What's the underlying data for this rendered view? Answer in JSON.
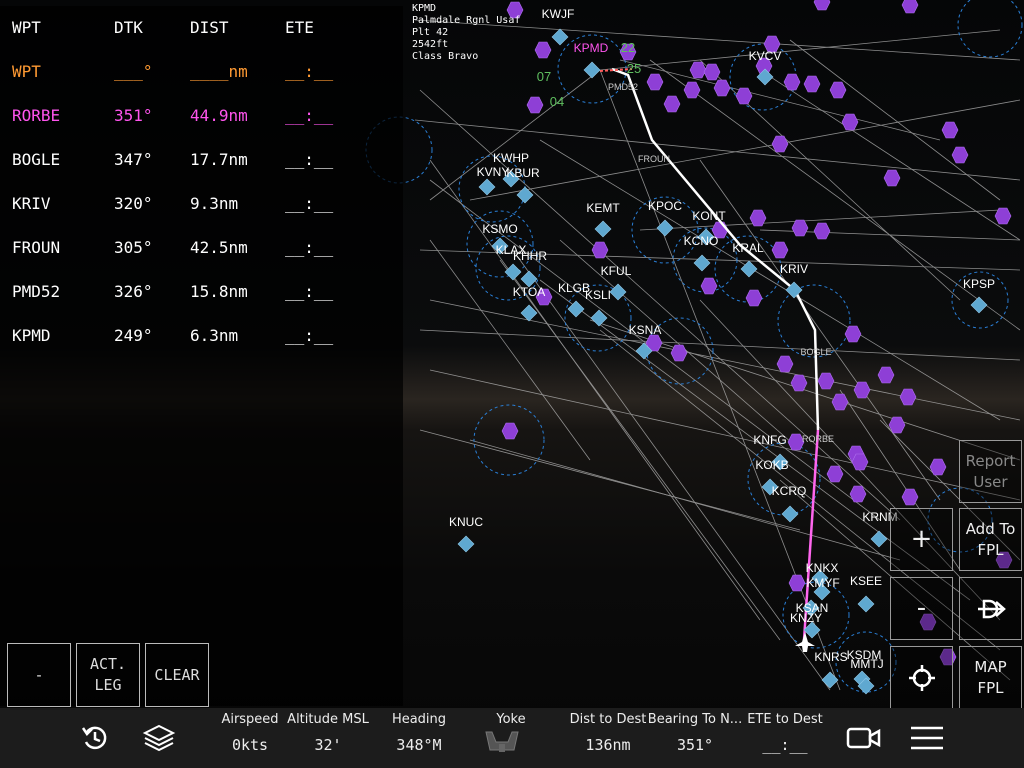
{
  "colors": {
    "active_waypoint": "#ff9a33",
    "next_waypoint": "#ff55ee",
    "normal_text": "#ffffff",
    "route_line": "#ffffff",
    "active_leg": "#ff66ee",
    "airport_fill": "#5fa8d0",
    "navaid_fill": "#8e3fd6",
    "range_ring": "#2a7fd6",
    "airway_line": "#b0b0b0",
    "runway_label": "#5fbf5f"
  },
  "flight_plan": {
    "headers": {
      "wpt": "WPT",
      "dtk": "DTK",
      "dist": "DIST",
      "ete": "ETE"
    },
    "rows": [
      {
        "wpt": "WPT",
        "dtk": "___°",
        "dist": "____nm",
        "ete": "__:__",
        "state": "active"
      },
      {
        "wpt": "RORBE",
        "dtk": "351°",
        "dist": "44.9nm",
        "ete": "__:__",
        "state": "next"
      },
      {
        "wpt": "BOGLE",
        "dtk": "347°",
        "dist": "17.7nm",
        "ete": "__:__",
        "state": "normal"
      },
      {
        "wpt": "KRIV",
        "dtk": "320°",
        "dist": "9.3nm",
        "ete": "__:__",
        "state": "normal"
      },
      {
        "wpt": "FROUN",
        "dtk": "305°",
        "dist": "42.5nm",
        "ete": "__:__",
        "state": "normal"
      },
      {
        "wpt": "PMD52",
        "dtk": "326°",
        "dist": "15.8nm",
        "ete": "__:__",
        "state": "normal"
      },
      {
        "wpt": "KPMD",
        "dtk": "249°",
        "dist": "6.3nm",
        "ete": "__:__",
        "state": "normal"
      }
    ],
    "buttons": {
      "minus": "-",
      "act_leg": "ACT.\nLEG",
      "clear": "CLEAR"
    }
  },
  "airport_info": {
    "ident": "KPMD",
    "name": "Palmdale Rgnl Usaf",
    "plant": "Plt 42",
    "elevation": "2542ft",
    "class": "Class Bravo"
  },
  "map": {
    "airports": [
      "KPMD",
      "KVCV",
      "KWJF",
      "KWHP",
      "KVNY",
      "KBUR",
      "KEMT",
      "KPOC",
      "KONT",
      "KCNO",
      "KRAL",
      "KSMO",
      "KLAX",
      "KHHR",
      "KFUL",
      "KTOA",
      "KLGB",
      "KSLI",
      "KSNA",
      "KRIV",
      "KPSP",
      "KNFG",
      "KOKB",
      "KCRQ",
      "KNUC",
      "KRNM",
      "KNKX",
      "KMYF",
      "KSEE",
      "KSAN",
      "KNZY",
      "KNRS",
      "KSDM",
      "MMTJ"
    ],
    "waypoint_labels": [
      "PMD52",
      "FROUN",
      "BOGLE",
      "RORBE"
    ],
    "runway_labels": [
      "22",
      "25",
      "07",
      "04"
    ],
    "ownship_icon": "airplane-icon"
  },
  "right_buttons": {
    "report_user": "Report\nUser",
    "zoom_in": "+",
    "add_to_fpl": "Add To\nFPL",
    "zoom_out": "-",
    "direct_to_icon": "direct-to-icon",
    "center_icon": "crosshair-icon",
    "map_fpl": "MAP\nFPL"
  },
  "bottom_bar": {
    "icons": [
      "restart-icon",
      "layers-icon",
      "yoke-icon",
      "camera-icon",
      "menu-icon"
    ],
    "stats": [
      {
        "label": "Airspeed",
        "value": "0kts"
      },
      {
        "label": "Altitude MSL",
        "value": "32'"
      },
      {
        "label": "Heading",
        "value": "348°M"
      },
      {
        "label": "Yoke",
        "value": ""
      },
      {
        "label": "Dist to Dest",
        "value": "136nm"
      },
      {
        "label": "Bearing To N...",
        "value": "351°"
      },
      {
        "label": "ETE to Dest",
        "value": "__:__"
      }
    ]
  }
}
